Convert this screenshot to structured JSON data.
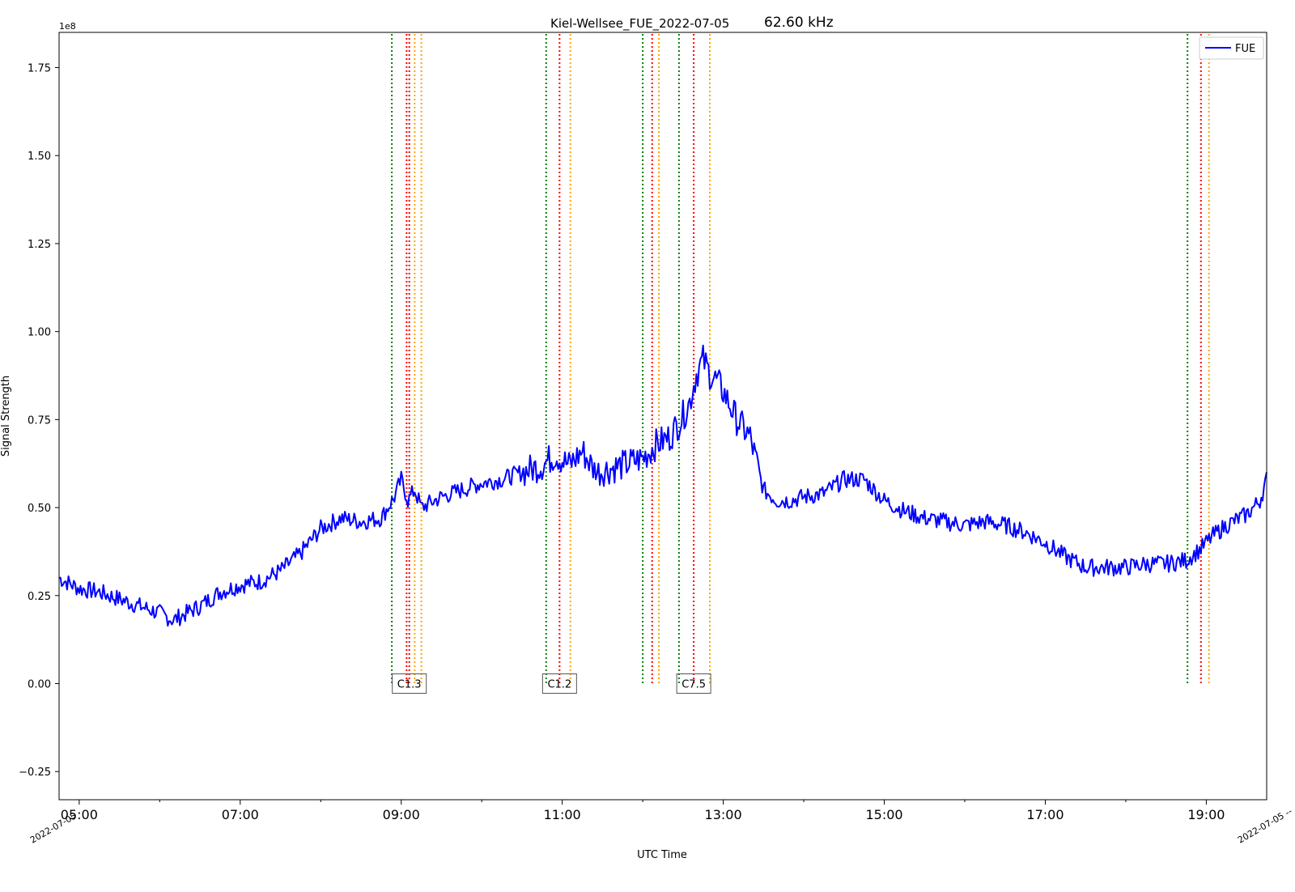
{
  "chart_data": {
    "type": "line",
    "title": "Kiel-Wellsee_FUE_2022-07-05",
    "frequency_label": "62.60 kHz",
    "xlabel": "UTC Time",
    "ylabel": "Signal Strength",
    "y_offset_label": "1e8",
    "y_scale": 100000000,
    "xlim": [
      "04:45",
      "19:45"
    ],
    "ylim": [
      -0.33,
      1.85
    ],
    "y_ticks": [
      -0.25,
      0.0,
      0.25,
      0.5,
      0.75,
      1.0,
      1.25,
      1.5,
      1.75
    ],
    "y_tick_labels": [
      "−0.25",
      "0.00",
      "0.25",
      "0.50",
      "0.75",
      "1.00",
      "1.25",
      "1.50",
      "1.75"
    ],
    "x_ticks": [
      "05:00",
      "07:00",
      "09:00",
      "11:00",
      "13:00",
      "15:00",
      "17:00",
      "19:00"
    ],
    "x_tick_labels": [
      "05:00",
      "07:00",
      "09:00",
      "11:00",
      "13:00",
      "15:00",
      "17:00",
      "19:00"
    ],
    "x_corner_labels": [
      "2022-07-05",
      "2022-07-05 --"
    ],
    "legend": {
      "position": "top-right",
      "entries": [
        "FUE"
      ]
    },
    "grid": false,
    "series": [
      {
        "name": "FUE",
        "color": "#0000ff",
        "x": [
          "04:45",
          "05:00",
          "05:15",
          "05:30",
          "05:45",
          "06:00",
          "06:10",
          "06:20",
          "06:30",
          "06:45",
          "07:00",
          "07:15",
          "07:30",
          "07:45",
          "08:00",
          "08:15",
          "08:30",
          "08:45",
          "08:55",
          "09:00",
          "09:05",
          "09:10",
          "09:15",
          "09:30",
          "09:45",
          "10:00",
          "10:15",
          "10:30",
          "10:45",
          "10:55",
          "11:05",
          "11:15",
          "11:25",
          "11:35",
          "11:45",
          "12:00",
          "12:10",
          "12:20",
          "12:30",
          "12:35",
          "12:40",
          "12:45",
          "12:50",
          "12:55",
          "13:00",
          "13:10",
          "13:20",
          "13:30",
          "13:40",
          "13:50",
          "14:00",
          "14:15",
          "14:30",
          "14:45",
          "15:00",
          "15:15",
          "15:30",
          "15:45",
          "16:00",
          "16:15",
          "16:30",
          "16:45",
          "17:00",
          "17:15",
          "17:30",
          "17:45",
          "18:00",
          "18:15",
          "18:30",
          "18:45",
          "18:55",
          "19:05",
          "19:15",
          "19:30",
          "19:40",
          "19:45"
        ],
        "y": [
          0.3,
          0.27,
          0.26,
          0.24,
          0.22,
          0.2,
          0.18,
          0.2,
          0.22,
          0.26,
          0.28,
          0.29,
          0.32,
          0.37,
          0.44,
          0.47,
          0.46,
          0.47,
          0.53,
          0.58,
          0.52,
          0.55,
          0.5,
          0.53,
          0.55,
          0.57,
          0.58,
          0.6,
          0.62,
          0.65,
          0.62,
          0.66,
          0.6,
          0.61,
          0.62,
          0.64,
          0.68,
          0.7,
          0.76,
          0.8,
          0.88,
          0.92,
          0.88,
          0.86,
          0.83,
          0.75,
          0.7,
          0.55,
          0.52,
          0.52,
          0.53,
          0.54,
          0.58,
          0.58,
          0.52,
          0.49,
          0.47,
          0.46,
          0.45,
          0.46,
          0.45,
          0.43,
          0.4,
          0.36,
          0.33,
          0.33,
          0.33,
          0.34,
          0.34,
          0.35,
          0.38,
          0.42,
          0.45,
          0.48,
          0.52,
          0.58
        ]
      }
    ],
    "flare_events": [
      {
        "label": "C1.3",
        "start": "08:53",
        "peak": "09:06",
        "end": "09:15",
        "extra_end": "09:10",
        "extra_peak": "09:04"
      },
      {
        "label": "C1.2",
        "start": "10:48",
        "peak": "10:58",
        "end": "11:06"
      },
      {
        "label": "",
        "start": "12:00",
        "peak": "12:07",
        "end": "12:12"
      },
      {
        "label": "C7.5",
        "start": "12:27",
        "peak": "12:38",
        "end": "12:50"
      },
      {
        "label": "",
        "start": "18:46",
        "peak": "18:56",
        "end": "19:02"
      }
    ],
    "event_line_colors": {
      "start": "#008000",
      "peak": "#ff0000",
      "end": "#ffa500"
    }
  }
}
